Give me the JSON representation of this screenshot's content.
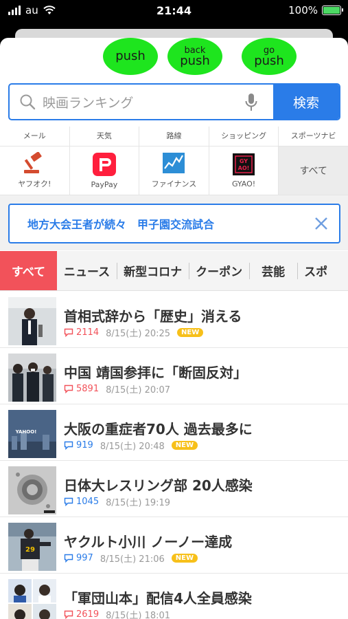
{
  "status_bar": {
    "carrier": "au",
    "time": "21:44",
    "battery": "100%",
    "battery_level": 1.0
  },
  "push_buttons": [
    {
      "top": "",
      "label": "push"
    },
    {
      "top": "back",
      "label": "push"
    },
    {
      "top": "go",
      "label": "push"
    }
  ],
  "search": {
    "placeholder": "映画ランキング",
    "button": "検索"
  },
  "services": {
    "labels": [
      "メール",
      "天気",
      "路線",
      "ショッピング",
      "スポーツナビ"
    ],
    "items": [
      {
        "label": "ヤフオク!",
        "icon": "gavel-icon"
      },
      {
        "label": "PayPay",
        "icon": "paypay-icon"
      },
      {
        "label": "ファイナンス",
        "icon": "chart-icon"
      },
      {
        "label": "GYAO!",
        "icon": "gyao-icon"
      },
      {
        "label": "すべて",
        "icon": ""
      }
    ]
  },
  "banner": {
    "text": "地方大会王者が続々　甲子園交流試合"
  },
  "tabs": [
    "すべて",
    "ニュース",
    "新型コロナ",
    "クーポン",
    "芸能",
    "スポ"
  ],
  "news": [
    {
      "title": "首相式辞から「歴史」消える",
      "count": "2114",
      "count_color": "red",
      "date": "8/15(土) 20:25",
      "new": "NEW"
    },
    {
      "title": "中国 靖国参拝に「断固反対」",
      "count": "5891",
      "count_color": "red",
      "date": "8/15(土) 20:07",
      "new": ""
    },
    {
      "title": "大阪の重症者70人 過去最多に",
      "count": "919",
      "count_color": "blue",
      "date": "8/15(土) 20:48",
      "new": "NEW"
    },
    {
      "title": "日体大レスリング部 20人感染",
      "count": "1045",
      "count_color": "blue",
      "date": "8/15(土) 19:19",
      "new": ""
    },
    {
      "title": "ヤクルト小川 ノーノー達成",
      "count": "997",
      "count_color": "blue",
      "date": "8/15(土) 21:06",
      "new": "NEW"
    },
    {
      "title": "「軍団山本」配信4人全員感染",
      "count": "2619",
      "count_color": "red",
      "date": "8/15(土) 18:01",
      "new": ""
    }
  ],
  "thumb_text": {
    "yahoo": "YAHOO!"
  },
  "colors": {
    "accent": "#2a7ce8",
    "tab_active": "#f2525a",
    "push": "#1ee51e",
    "new_badge": "#f7c01a"
  }
}
